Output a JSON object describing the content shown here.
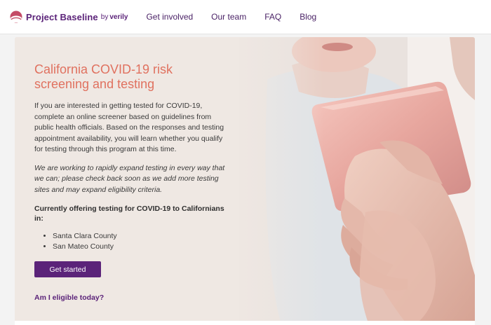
{
  "brand": {
    "name": "Project Baseline",
    "by": "by",
    "partner": "verily",
    "accent_color": "#5b2379"
  },
  "nav": {
    "items": [
      {
        "label": "Get involved"
      },
      {
        "label": "Our team"
      },
      {
        "label": "FAQ"
      },
      {
        "label": "Blog"
      }
    ]
  },
  "hero": {
    "title": "California COVID-19 risk screening and testing",
    "title_color": "#e0715f",
    "paragraph": "If you are interested in getting tested for COVID-19, complete an online screener based on guidelines from public health officials. Based on the responses and testing appointment availability, you will learn whether you qualify for testing through this program at this time.",
    "note": "We are working to rapidly expand testing in every way that we can; please check back soon as we add more testing sites and may expand eligibility criteria.",
    "offering_heading": "Currently offering testing for COVID-19 to Californians in:",
    "counties": [
      "Santa Clara County",
      "San Mateo County"
    ],
    "cta_label": "Get started",
    "eligibility_link": "Am I eligible today?",
    "image_subject": "elderly-hands-holding-tablet-photo"
  }
}
